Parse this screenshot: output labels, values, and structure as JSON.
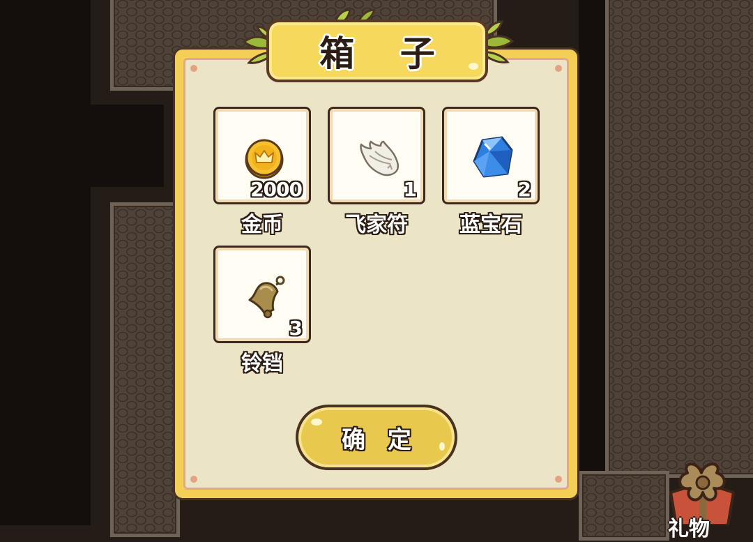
{
  "dialog": {
    "title": "箱 子",
    "items": [
      {
        "icon": "gold-coin-icon",
        "label": "金币",
        "quantity": "2000"
      },
      {
        "icon": "wing-icon",
        "label": "飞家符",
        "quantity": "1"
      },
      {
        "icon": "blue-gem-icon",
        "label": "蓝宝石",
        "quantity": "2"
      },
      {
        "icon": "bell-icon",
        "label": "铃铛",
        "quantity": "3"
      }
    ],
    "confirm_label": "确 定"
  },
  "hud": {
    "gift_icon": "gift-box-icon",
    "gift_label": "礼物"
  },
  "colors": {
    "dialog_frame": "#f4cf55",
    "dialog_panel": "#ece4c6",
    "outline": "#4a3222",
    "card_bg": "#fffdf4",
    "background": "#241c17"
  }
}
